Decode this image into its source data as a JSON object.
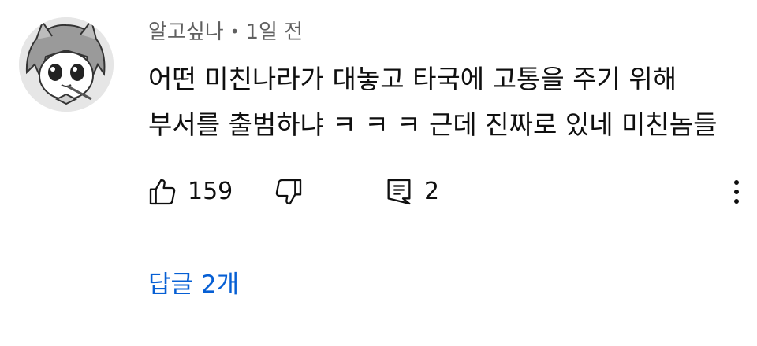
{
  "comment": {
    "author": "알고싶나",
    "separator": "•",
    "time": "1일 전",
    "lines": [
      "어떤 미친나라가 대놓고 타국에 고통을 주기 위해",
      "부서를 출범하냐 ㅋ ㅋ ㅋ 근데 진짜로 있네 미친놈들"
    ]
  },
  "actions": {
    "like_count": "159",
    "reply_count": "2",
    "icons": {
      "like": "thumbs-up-icon",
      "dislike": "thumbs-down-icon",
      "reply": "comment-icon",
      "more": "more-vertical-icon"
    }
  },
  "replies": {
    "label": "답글 2개"
  },
  "colors": {
    "text": "#0f0f0f",
    "meta": "#606060",
    "link": "#065fd4",
    "background": "#ffffff"
  }
}
